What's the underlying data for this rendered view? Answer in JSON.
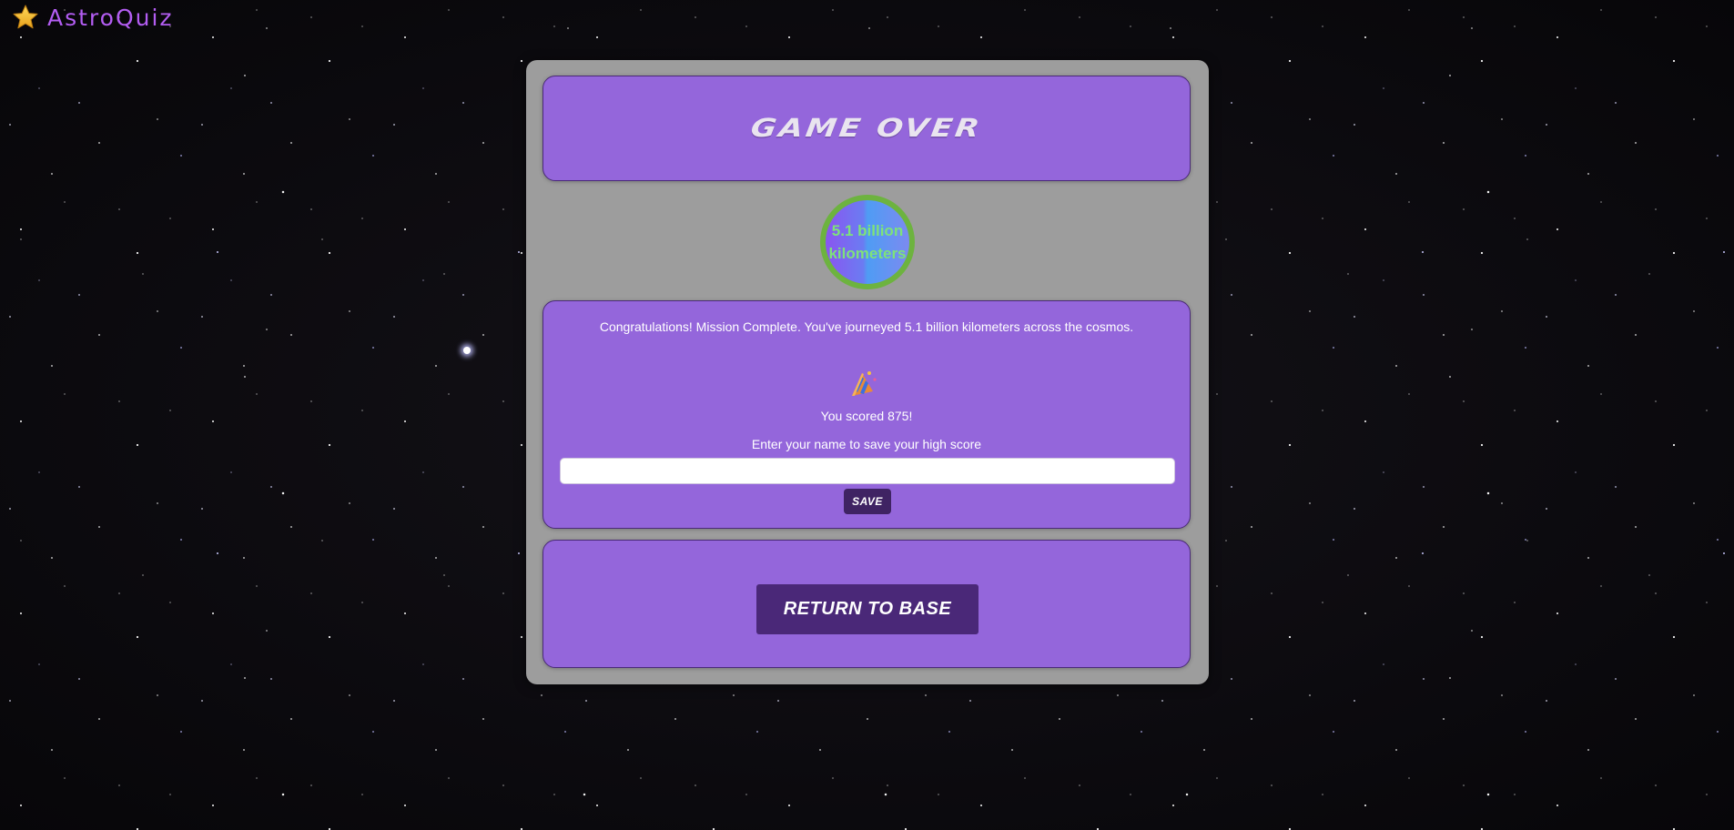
{
  "brand": {
    "name": "AstroQuiz",
    "icon": "star-icon",
    "color": "#b35df2"
  },
  "game_over": {
    "title": "GAME OVER",
    "distance_badge": {
      "line1": "5.1 billion",
      "line2": "kilometers"
    },
    "congrats_message": "Congratulations! Mission Complete. You've journeyed 5.1 billion kilometers across the cosmos.",
    "celebration_icon": "party-popper-icon",
    "score_text": "You scored 875!",
    "name_prompt": "Enter your name to save your high score",
    "name_input": {
      "value": "",
      "placeholder": ""
    },
    "save_label": "SAVE",
    "return_label": "RETURN TO BASE"
  },
  "colors": {
    "card": "#9466db",
    "panel": "#9d9d9d",
    "button": "#4a2878",
    "badge_ring": "#6db33f",
    "badge_text": "#7ee27a"
  }
}
